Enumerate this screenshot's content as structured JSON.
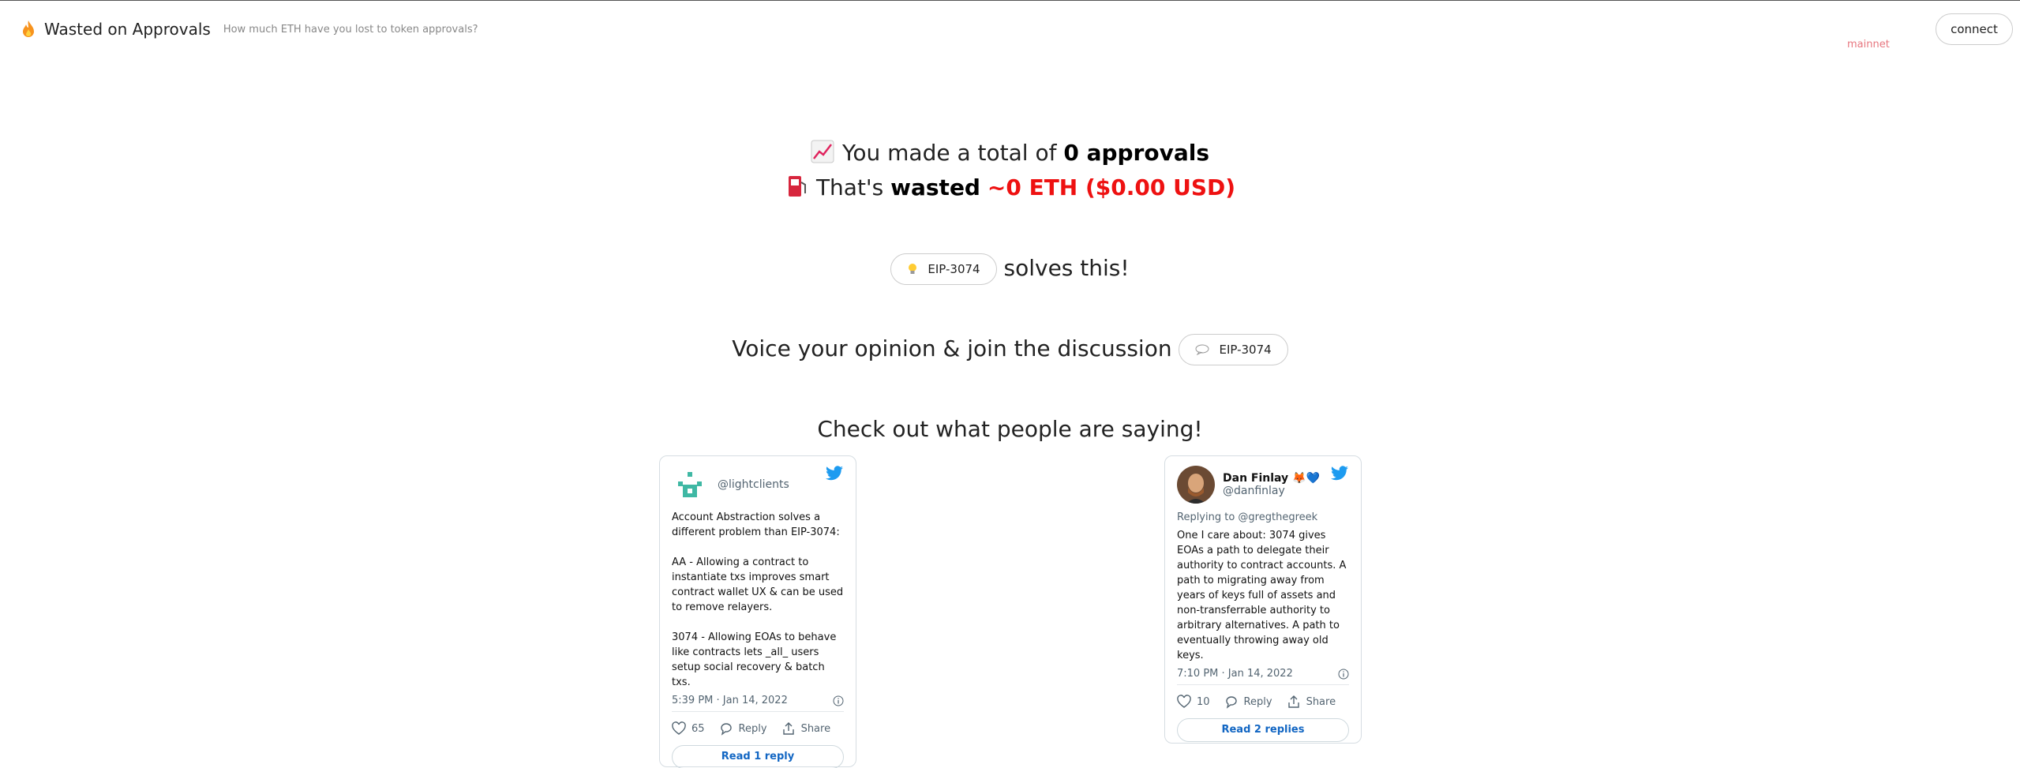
{
  "header": {
    "title": "Wasted on Approvals",
    "tagline": "How much ETH have you lost to token approvals?",
    "network": "mainnet",
    "connect_label": "connect"
  },
  "summary": {
    "line1_prefix": "You made a total of",
    "approvals_value": "0 approvals",
    "line2_prefix": "That's",
    "wasted_word": "wasted",
    "wasted_amount": "~0 ETH ($0.00 USD)"
  },
  "cta": {
    "eip_pill_label": "EIP-3074",
    "solves_text": "solves this!",
    "voice_text": "Voice your opinion & join the discussion",
    "discussion_pill_label": "EIP-3074",
    "check_text": "Check out what people are saying!"
  },
  "tweets": [
    {
      "display_name": "",
      "handle": "@lightclients",
      "body": "Account Abstraction solves a different problem than EIP-3074:\n\nAA - Allowing a contract to instantiate txs improves smart contract wallet UX & can be used to remove relayers.\n\n3074 - Allowing EOAs to behave like contracts lets _all_ users setup social recovery & batch txs.",
      "timestamp": "5:39 PM · Jan 14, 2022",
      "likes": "65",
      "reply_label": "Reply",
      "share_label": "Share",
      "read_replies": "Read 1 reply"
    },
    {
      "display_name": "Dan Finlay 🦊💙",
      "handle": "@danfinlay",
      "replying_to": "Replying to @gregthegreek",
      "body": "One I care about: 3074 gives EOAs a path to delegate their authority to contract accounts. A path to migrating away from years of keys full of assets and non-transferrable authority to arbitrary alternatives. A path to eventually throwing away old keys.",
      "timestamp": "7:10 PM · Jan 14, 2022",
      "likes": "10",
      "reply_label": "Reply",
      "share_label": "Share",
      "read_replies": "Read 2 replies"
    }
  ],
  "colors": {
    "accent_red": "#ee1111",
    "network_pink": "#e7767f",
    "twitter_blue": "#1d9bf0",
    "link_blue": "#1266c3"
  },
  "icons": [
    "flame-icon",
    "chart-increasing-icon",
    "fuel-pump-icon",
    "lightbulb-icon",
    "speech-bubble-icon",
    "twitter-bird-icon",
    "info-icon",
    "heart-icon",
    "reply-icon",
    "share-icon"
  ]
}
